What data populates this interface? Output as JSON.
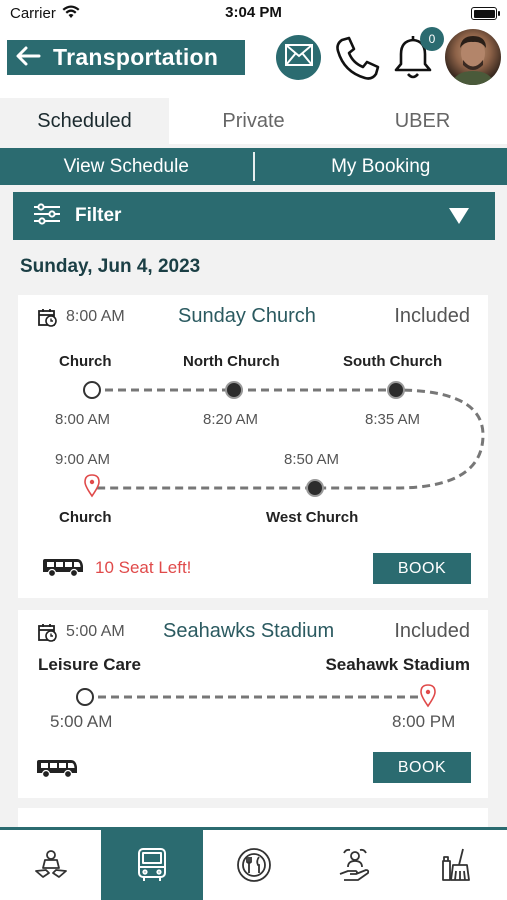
{
  "status_bar": {
    "carrier": "Carrier",
    "time": "3:04 PM"
  },
  "header": {
    "title": "Transportation",
    "notification_count": "0"
  },
  "tabs": [
    {
      "label": "Scheduled",
      "active": true
    },
    {
      "label": "Private",
      "active": false
    },
    {
      "label": "UBER",
      "active": false
    }
  ],
  "subtabs": [
    {
      "label": "View Schedule"
    },
    {
      "label": "My Booking"
    }
  ],
  "filter": {
    "label": "Filter"
  },
  "date_heading": "Sunday, Jun 4, 2023",
  "trips": [
    {
      "time": "8:00 AM",
      "title": "Sunday Church",
      "status": "Included",
      "stops": [
        {
          "name": "Church",
          "time": "8:00 AM"
        },
        {
          "name": "North Church",
          "time": "8:20 AM"
        },
        {
          "name": "South Church",
          "time": "8:35 AM"
        },
        {
          "name": "West Church",
          "time": "8:50 AM"
        },
        {
          "name": "Church",
          "time": "9:00 AM"
        }
      ],
      "seats_left": "10 Seat Left!",
      "book_label": "BOOK"
    },
    {
      "time": "5:00 AM",
      "title": "Seahawks Stadium",
      "status": "Included",
      "origin": {
        "name": "Leisure Care",
        "time": "5:00 AM"
      },
      "destination": {
        "name": "Seahawk Stadium",
        "time": "8:00 PM"
      },
      "book_label": "BOOK"
    }
  ],
  "bottom_nav": [
    {
      "icon": "hands-service-icon",
      "active": false
    },
    {
      "icon": "bus-icon",
      "active": true
    },
    {
      "icon": "dining-icon",
      "active": false
    },
    {
      "icon": "care-hand-icon",
      "active": false
    },
    {
      "icon": "housekeeping-icon",
      "active": false
    }
  ],
  "colors": {
    "primary": "#2b6b70",
    "alert": "#e04a4a",
    "background": "#f2f2f2"
  }
}
